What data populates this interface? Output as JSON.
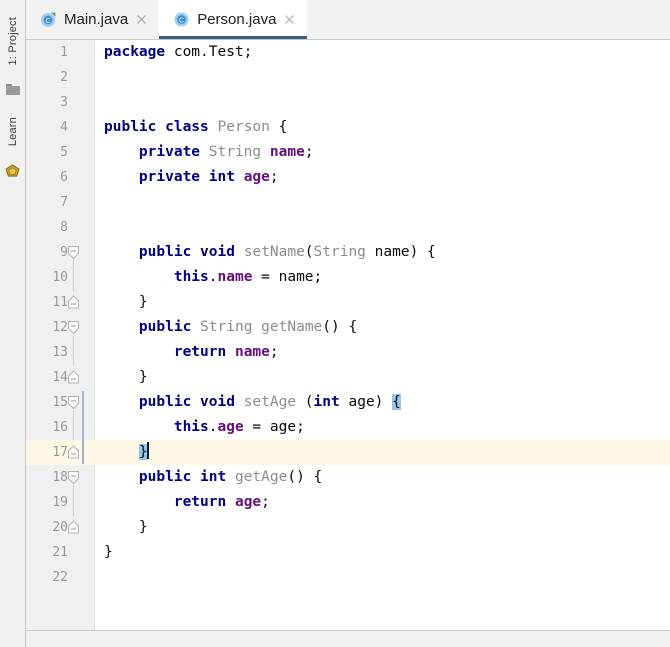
{
  "window": {
    "app": "IntelliJ IDEA",
    "active_file": "Person.java"
  },
  "tool_stripe": {
    "items": [
      {
        "label": "1: Project",
        "icon": "project-panel-icon",
        "type": "text"
      },
      {
        "label": "",
        "icon": "folder-icon",
        "type": "icon"
      },
      {
        "label": "Learn",
        "icon": "learn-panel-icon",
        "type": "text"
      },
      {
        "label": "",
        "icon": "gem-icon",
        "type": "icon"
      }
    ]
  },
  "tabs": [
    {
      "label": "Main.java",
      "icon": "java-runnable-class-icon",
      "active": false,
      "close_icon": "close-icon"
    },
    {
      "label": "Person.java",
      "icon": "java-class-icon",
      "active": true,
      "close_icon": "close-icon"
    }
  ],
  "editor": {
    "language": "java",
    "total_lines": 22,
    "current_line": 17,
    "caret_line": 17,
    "caret_column": 6,
    "changed_lines": [
      15,
      16,
      17
    ],
    "matching_brace_lines": [
      15,
      17
    ],
    "colors": {
      "keyword": "#000080",
      "field": "#660e7a",
      "identifier": "#8c8c8c",
      "text": "#080808",
      "background": "#ffffff",
      "gutter": "#f0f0f0",
      "current_line": "#fdf8e6",
      "brace_highlight": "#93c6ef",
      "change_bar": "#a0b3c7",
      "tab_underline": "#3d6185"
    },
    "lines": [
      {
        "n": 1,
        "text": "package com.Test;",
        "tokens": [
          {
            "t": "package",
            "c": "kw"
          },
          {
            "t": " com.Test;",
            "c": "plain"
          }
        ],
        "fold": "none",
        "indent": 0
      },
      {
        "n": 2,
        "text": "",
        "tokens": [],
        "fold": "none",
        "indent": 0
      },
      {
        "n": 3,
        "text": "",
        "tokens": [],
        "fold": "none",
        "indent": 0
      },
      {
        "n": 4,
        "text": "public class Person {",
        "tokens": [
          {
            "t": "public class",
            "c": "kw"
          },
          {
            "t": " ",
            "c": "plain"
          },
          {
            "t": "Person",
            "c": "ident"
          },
          {
            "t": " {",
            "c": "plain"
          }
        ],
        "fold": "none",
        "indent": 0
      },
      {
        "n": 5,
        "text": "    private String name;",
        "tokens": [
          {
            "t": "    ",
            "c": "plain"
          },
          {
            "t": "private",
            "c": "kw"
          },
          {
            "t": " ",
            "c": "plain"
          },
          {
            "t": "String",
            "c": "ident"
          },
          {
            "t": " ",
            "c": "plain"
          },
          {
            "t": "name",
            "c": "field"
          },
          {
            "t": ";",
            "c": "plain"
          }
        ],
        "fold": "none",
        "indent": 1
      },
      {
        "n": 6,
        "text": "    private int age;",
        "tokens": [
          {
            "t": "    ",
            "c": "plain"
          },
          {
            "t": "private int",
            "c": "kw"
          },
          {
            "t": " ",
            "c": "plain"
          },
          {
            "t": "age",
            "c": "field"
          },
          {
            "t": ";",
            "c": "plain"
          }
        ],
        "fold": "none",
        "indent": 1
      },
      {
        "n": 7,
        "text": "",
        "tokens": [],
        "fold": "none",
        "indent": 0
      },
      {
        "n": 8,
        "text": "",
        "tokens": [],
        "fold": "none",
        "indent": 0
      },
      {
        "n": 9,
        "text": "    public void setName(String name) {",
        "tokens": [
          {
            "t": "    ",
            "c": "plain"
          },
          {
            "t": "public void",
            "c": "kw"
          },
          {
            "t": " ",
            "c": "plain"
          },
          {
            "t": "setName",
            "c": "ident"
          },
          {
            "t": "(",
            "c": "plain"
          },
          {
            "t": "String",
            "c": "ident"
          },
          {
            "t": " name) {",
            "c": "plain"
          }
        ],
        "fold": "expanded-top",
        "indent": 1
      },
      {
        "n": 10,
        "text": "        this.name = name;",
        "tokens": [
          {
            "t": "        ",
            "c": "plain"
          },
          {
            "t": "this",
            "c": "kw"
          },
          {
            "t": ".",
            "c": "plain"
          },
          {
            "t": "name",
            "c": "field"
          },
          {
            "t": " = name;",
            "c": "plain"
          }
        ],
        "fold": "none",
        "indent": 2
      },
      {
        "n": 11,
        "text": "    }",
        "tokens": [
          {
            "t": "    }",
            "c": "plain"
          }
        ],
        "fold": "expanded-bottom",
        "indent": 1
      },
      {
        "n": 12,
        "text": "    public String getName() {",
        "tokens": [
          {
            "t": "    ",
            "c": "plain"
          },
          {
            "t": "public",
            "c": "kw"
          },
          {
            "t": " ",
            "c": "plain"
          },
          {
            "t": "String",
            "c": "ident"
          },
          {
            "t": " ",
            "c": "plain"
          },
          {
            "t": "getName",
            "c": "ident"
          },
          {
            "t": "() {",
            "c": "plain"
          }
        ],
        "fold": "expanded-top",
        "indent": 1
      },
      {
        "n": 13,
        "text": "        return name;",
        "tokens": [
          {
            "t": "        ",
            "c": "plain"
          },
          {
            "t": "return",
            "c": "kw"
          },
          {
            "t": " ",
            "c": "plain"
          },
          {
            "t": "name",
            "c": "field"
          },
          {
            "t": ";",
            "c": "plain"
          }
        ],
        "fold": "none",
        "indent": 2
      },
      {
        "n": 14,
        "text": "    }",
        "tokens": [
          {
            "t": "    }",
            "c": "plain"
          }
        ],
        "fold": "expanded-bottom",
        "indent": 1
      },
      {
        "n": 15,
        "text": "    public void setAge (int age) {",
        "tokens": [
          {
            "t": "    ",
            "c": "plain"
          },
          {
            "t": "public void",
            "c": "kw"
          },
          {
            "t": " ",
            "c": "plain"
          },
          {
            "t": "setAge",
            "c": "ident"
          },
          {
            "t": " (",
            "c": "plain"
          },
          {
            "t": "int",
            "c": "kw"
          },
          {
            "t": " age) ",
            "c": "plain"
          },
          {
            "t": "{",
            "c": "brace-hl"
          }
        ],
        "fold": "expanded-top",
        "indent": 1
      },
      {
        "n": 16,
        "text": "        this.age = age;",
        "tokens": [
          {
            "t": "        ",
            "c": "plain"
          },
          {
            "t": "this",
            "c": "kw"
          },
          {
            "t": ".",
            "c": "plain"
          },
          {
            "t": "age",
            "c": "field"
          },
          {
            "t": " = age;",
            "c": "plain"
          }
        ],
        "fold": "none",
        "indent": 2
      },
      {
        "n": 17,
        "text": "    }",
        "tokens": [
          {
            "t": "    ",
            "c": "plain"
          },
          {
            "t": "}",
            "c": "brace-hl"
          }
        ],
        "fold": "expanded-bottom",
        "indent": 1,
        "caret_after": true
      },
      {
        "n": 18,
        "text": "    public int getAge() {",
        "tokens": [
          {
            "t": "    ",
            "c": "plain"
          },
          {
            "t": "public int",
            "c": "kw"
          },
          {
            "t": " ",
            "c": "plain"
          },
          {
            "t": "getAge",
            "c": "ident"
          },
          {
            "t": "() {",
            "c": "plain"
          }
        ],
        "fold": "expanded-top",
        "indent": 1
      },
      {
        "n": 19,
        "text": "        return age;",
        "tokens": [
          {
            "t": "        ",
            "c": "plain"
          },
          {
            "t": "return",
            "c": "kw"
          },
          {
            "t": " ",
            "c": "plain"
          },
          {
            "t": "age",
            "c": "field"
          },
          {
            "t": ";",
            "c": "plain"
          }
        ],
        "fold": "none",
        "indent": 2
      },
      {
        "n": 20,
        "text": "    }",
        "tokens": [
          {
            "t": "    }",
            "c": "plain"
          }
        ],
        "fold": "expanded-bottom",
        "indent": 1
      },
      {
        "n": 21,
        "text": "}",
        "tokens": [
          {
            "t": "}",
            "c": "plain"
          }
        ],
        "fold": "none",
        "indent": 0
      },
      {
        "n": 22,
        "text": "",
        "tokens": [],
        "fold": "none",
        "indent": 0
      }
    ]
  }
}
